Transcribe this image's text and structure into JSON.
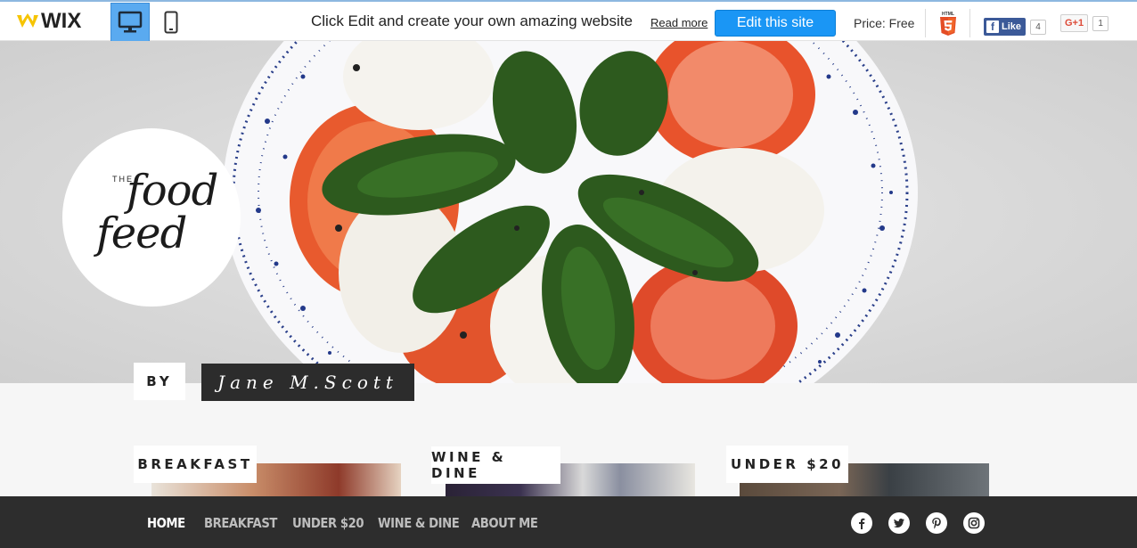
{
  "wix_bar": {
    "logo_text": "WIX",
    "promo_text": "Click Edit and create your own amazing website",
    "read_more": "Read more",
    "edit_button": "Edit this site",
    "price": "Price: Free",
    "html5_label": "HTML",
    "fb_like": "Like",
    "fb_count": "4",
    "gplus_label": "G+1",
    "gplus_count": "1",
    "device_icons": [
      "desktop-icon",
      "mobile-icon"
    ],
    "accent_color": "#1a96f5"
  },
  "site": {
    "logo": {
      "the": "THE",
      "line1": "food",
      "line2": "feed"
    },
    "byline": {
      "by": "BY",
      "author": "Jane M.Scott"
    },
    "categories": [
      {
        "label": "BREAKFAST"
      },
      {
        "label": "WINE & DINE"
      },
      {
        "label": "UNDER $20"
      }
    ],
    "nav": {
      "items": [
        "HOME",
        "BREAKFAST",
        "UNDER $20",
        "WINE & DINE",
        "ABOUT ME"
      ],
      "active": "HOME"
    },
    "social_icons": [
      "facebook-icon",
      "twitter-icon",
      "pinterest-icon",
      "instagram-icon"
    ]
  }
}
